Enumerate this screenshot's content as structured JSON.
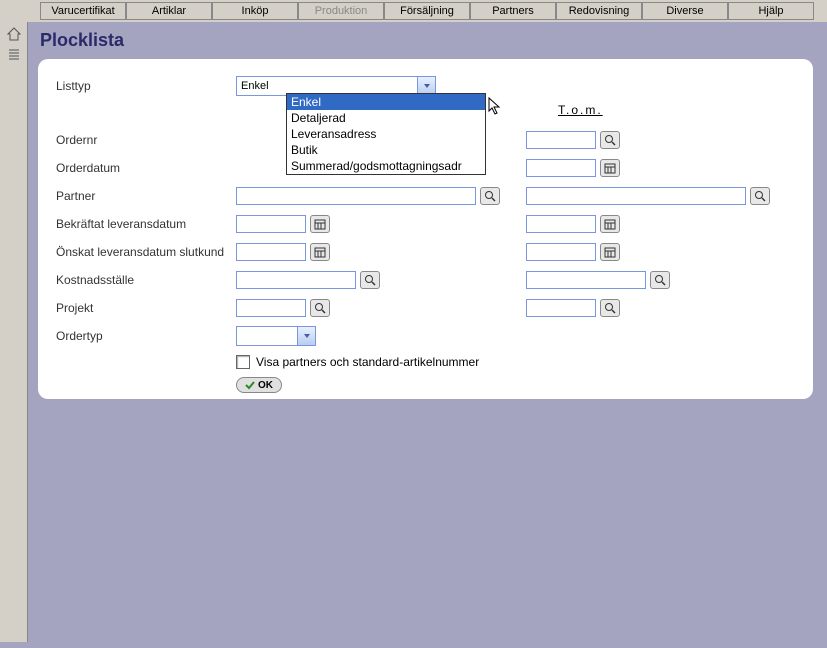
{
  "menu": {
    "items": [
      {
        "label": "Varucertifikat",
        "disabled": false
      },
      {
        "label": "Artiklar",
        "disabled": false
      },
      {
        "label": "Inköp",
        "disabled": false
      },
      {
        "label": "Produktion",
        "disabled": true
      },
      {
        "label": "Försäljning",
        "disabled": false
      },
      {
        "label": "Partners",
        "disabled": false
      },
      {
        "label": "Redovisning",
        "disabled": false
      },
      {
        "label": "Diverse",
        "disabled": false
      },
      {
        "label": "Hjälp",
        "disabled": false
      }
    ]
  },
  "page_title": "Plocklista",
  "section_tom": "T.o.m.",
  "form": {
    "listtyp_label": "Listtyp",
    "listtyp_value": "Enkel",
    "listtyp_options": [
      "Enkel",
      "Detaljerad",
      "Leveransadress",
      "Butik",
      "Summerad/godsmottagningsadr"
    ],
    "ordernr_label": "Ordernr",
    "orderdatum_label": "Orderdatum",
    "partner_label": "Partner",
    "bekraftat_label": "Bekräftat leveransdatum",
    "onskat_label": "Önskat leveransdatum slutkund",
    "kostnadsstalle_label": "Kostnadsställe",
    "projekt_label": "Projekt",
    "ordertyp_label": "Ordertyp",
    "ordertyp_value": "",
    "show_partners_label": "Visa partners och standard-artikelnummer",
    "ok_label": "OK"
  }
}
